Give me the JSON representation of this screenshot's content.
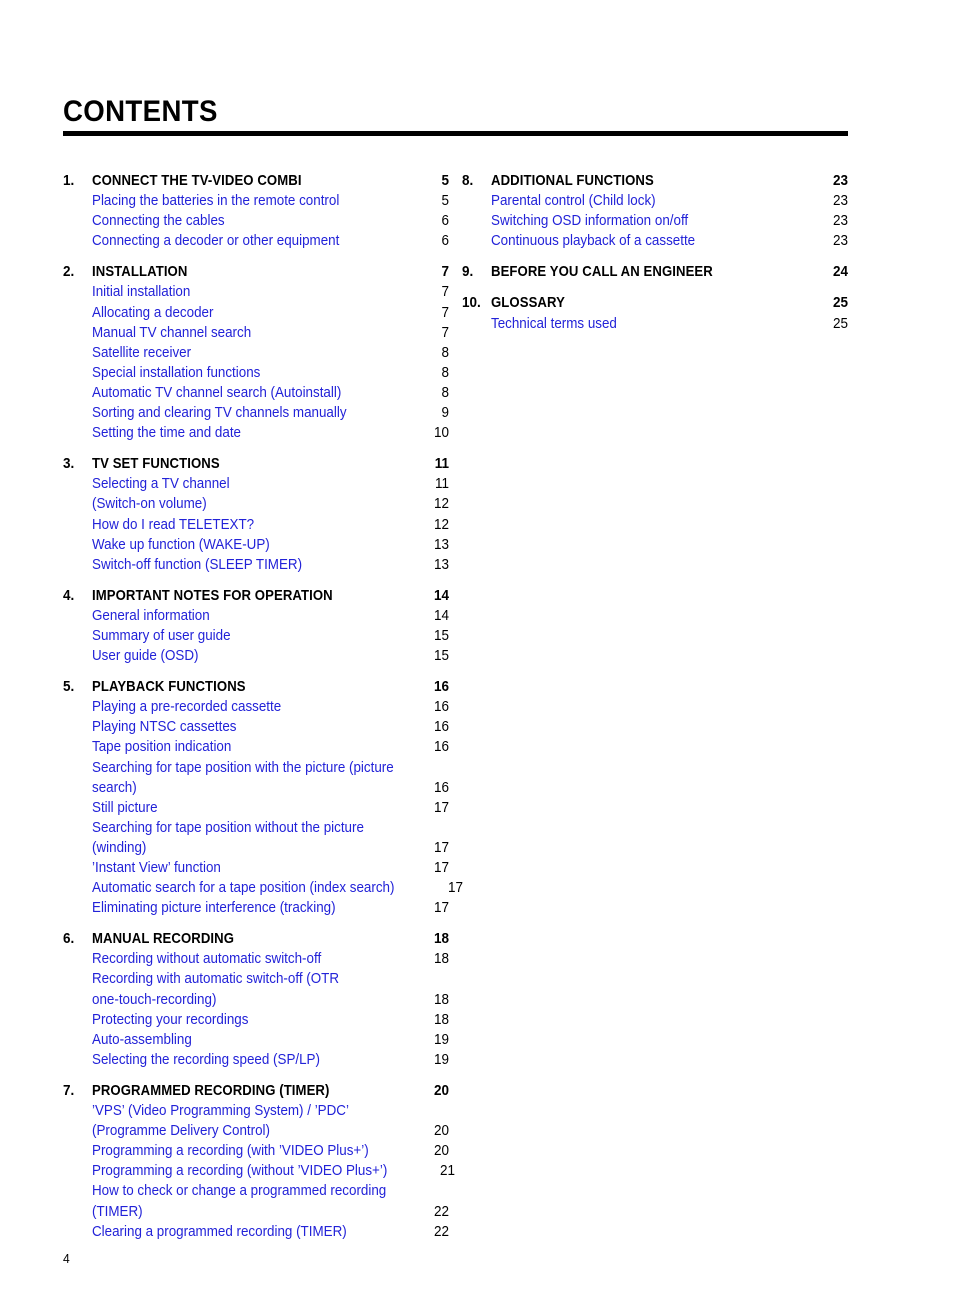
{
  "page_title": "CONTENTS",
  "folio": "4",
  "colors": {
    "subsection_blue": "#2222d8",
    "section_black": "#000000",
    "rule": "#000000"
  },
  "columns": {
    "left": [
      {
        "number": "1.",
        "title": "CONNECT THE TV-VIDEO COMBI",
        "page": "5",
        "items": [
          {
            "lines": [
              "Placing the batteries in the remote control"
            ],
            "page": "5"
          },
          {
            "lines": [
              "Connecting the cables"
            ],
            "page": "6"
          },
          {
            "lines": [
              "Connecting a decoder or other equipment"
            ],
            "page": "6"
          }
        ]
      },
      {
        "number": "2.",
        "title": "INSTALLATION",
        "page": "7",
        "items": [
          {
            "lines": [
              "Initial installation"
            ],
            "page": "7"
          },
          {
            "lines": [
              "Allocating a decoder"
            ],
            "page": "7"
          },
          {
            "lines": [
              "Manual TV channel search"
            ],
            "page": "7"
          },
          {
            "lines": [
              "Satellite receiver"
            ],
            "page": "8"
          },
          {
            "lines": [
              "Special installation functions"
            ],
            "page": "8"
          },
          {
            "lines": [
              "Automatic TV channel search (Autoinstall)"
            ],
            "page": "8"
          },
          {
            "lines": [
              "Sorting and clearing TV channels manually"
            ],
            "page": "9"
          },
          {
            "lines": [
              "Setting the time and date"
            ],
            "page": "10"
          }
        ]
      },
      {
        "number": "3.",
        "title": "TV SET FUNCTIONS",
        "page": "11",
        "items": [
          {
            "lines": [
              "Selecting a TV channel"
            ],
            "page": "11"
          },
          {
            "lines": [
              "(Switch-on volume)"
            ],
            "page": "12"
          },
          {
            "lines": [
              "How do I read TELETEXT?"
            ],
            "page": "12"
          },
          {
            "lines": [
              "Wake up function (WAKE-UP)"
            ],
            "page": "13"
          },
          {
            "lines": [
              "Switch-off function (SLEEP TIMER)"
            ],
            "page": "13"
          }
        ]
      },
      {
        "number": "4.",
        "title": "IMPORTANT NOTES FOR OPERATION",
        "page": "14",
        "items": [
          {
            "lines": [
              "General information"
            ],
            "page": "14"
          },
          {
            "lines": [
              "Summary of user guide"
            ],
            "page": "15"
          },
          {
            "lines": [
              "User guide (OSD)"
            ],
            "page": "15"
          }
        ]
      },
      {
        "number": "5.",
        "title": "PLAYBACK FUNCTIONS",
        "page": "16",
        "items": [
          {
            "lines": [
              "Playing a pre-recorded cassette"
            ],
            "page": "16"
          },
          {
            "lines": [
              "Playing NTSC cassettes"
            ],
            "page": "16"
          },
          {
            "lines": [
              "Tape position indication"
            ],
            "page": "16"
          },
          {
            "lines": [
              "Searching for tape position with the picture (picture",
              "search)"
            ],
            "page": "16"
          },
          {
            "lines": [
              "Still picture"
            ],
            "page": "17"
          },
          {
            "lines": [
              "Searching for tape position without the picture",
              "(winding)"
            ],
            "page": "17"
          },
          {
            "lines": [
              "’Instant View’ function"
            ],
            "page": "17"
          },
          {
            "lines": [
              "Automatic search for a tape position (index search)"
            ],
            "page": "17"
          },
          {
            "lines": [
              "Eliminating picture interference (tracking)"
            ],
            "page": "17"
          }
        ]
      },
      {
        "number": "6.",
        "title": "MANUAL RECORDING",
        "page": "18",
        "items": [
          {
            "lines": [
              "Recording without automatic switch-off"
            ],
            "page": "18"
          },
          {
            "lines": [
              "Recording with automatic switch-off (OTR",
              "one-touch-recording)"
            ],
            "page": "18"
          },
          {
            "lines": [
              "Protecting your recordings"
            ],
            "page": "18"
          },
          {
            "lines": [
              "Auto-assembling"
            ],
            "page": "19"
          },
          {
            "lines": [
              "Selecting the recording speed (SP/LP)"
            ],
            "page": "19"
          }
        ]
      },
      {
        "number": "7.",
        "title": "PROGRAMMED RECORDING (TIMER)",
        "page": "20",
        "items": [
          {
            "lines": [
              "’VPS’ (Video Programming System) / ’PDC’",
              "(Programme Delivery Control)"
            ],
            "page": "20"
          },
          {
            "lines": [
              "Programming a recording (with ’VIDEO Plus+’)"
            ],
            "page": "20"
          },
          {
            "lines": [
              "Programming a recording (without ’VIDEO Plus+’)"
            ],
            "page": "21"
          },
          {
            "lines": [
              "How to check or change a programmed recording",
              "(TIMER)"
            ],
            "page": "22"
          },
          {
            "lines": [
              "Clearing a programmed recording (TIMER)"
            ],
            "page": "22"
          }
        ]
      }
    ],
    "right": [
      {
        "number": "8.",
        "title": "ADDITIONAL FUNCTIONS",
        "page": "23",
        "items": [
          {
            "lines": [
              "Parental control (Child lock)"
            ],
            "page": "23"
          },
          {
            "lines": [
              "Switching OSD information on/off"
            ],
            "page": "23"
          },
          {
            "lines": [
              "Continuous playback of a cassette"
            ],
            "page": "23"
          }
        ]
      },
      {
        "number": "9.",
        "title": "BEFORE YOU CALL AN ENGINEER",
        "page": "24",
        "items": []
      },
      {
        "number": "10.",
        "title": "GLOSSARY",
        "page": "25",
        "items": [
          {
            "lines": [
              "Technical terms used"
            ],
            "page": "25"
          }
        ]
      }
    ]
  }
}
